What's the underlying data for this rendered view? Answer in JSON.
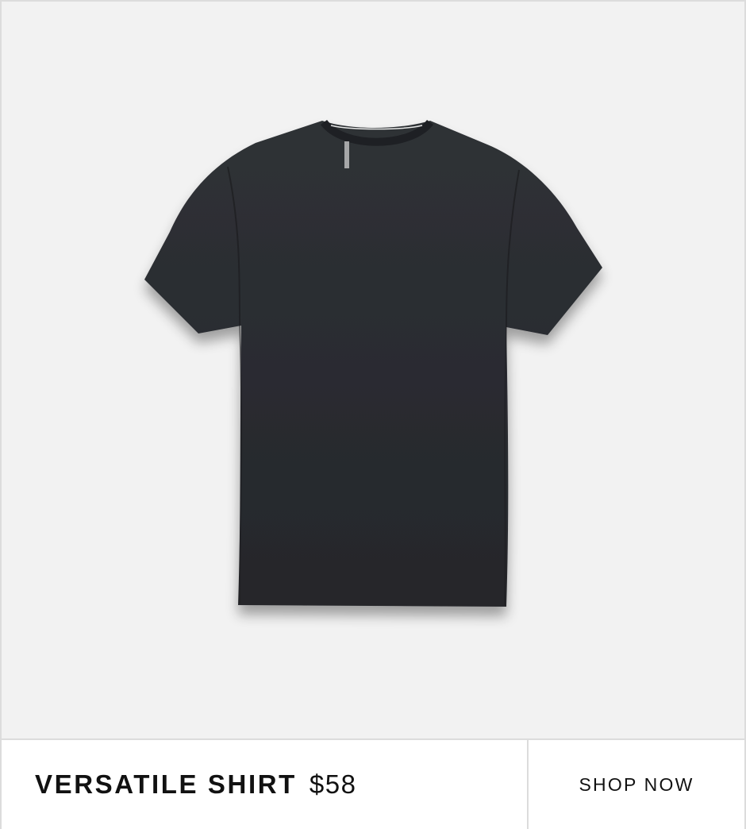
{
  "product": {
    "name": "VERSATILE SHIRT",
    "price": "$58",
    "image_icon": "t-shirt-image",
    "color": "#2a2c30"
  },
  "cta": {
    "label": "SHOP NOW"
  },
  "colors": {
    "background": "#f2f2f2",
    "border": "#dcdcdc",
    "text": "#111111"
  }
}
